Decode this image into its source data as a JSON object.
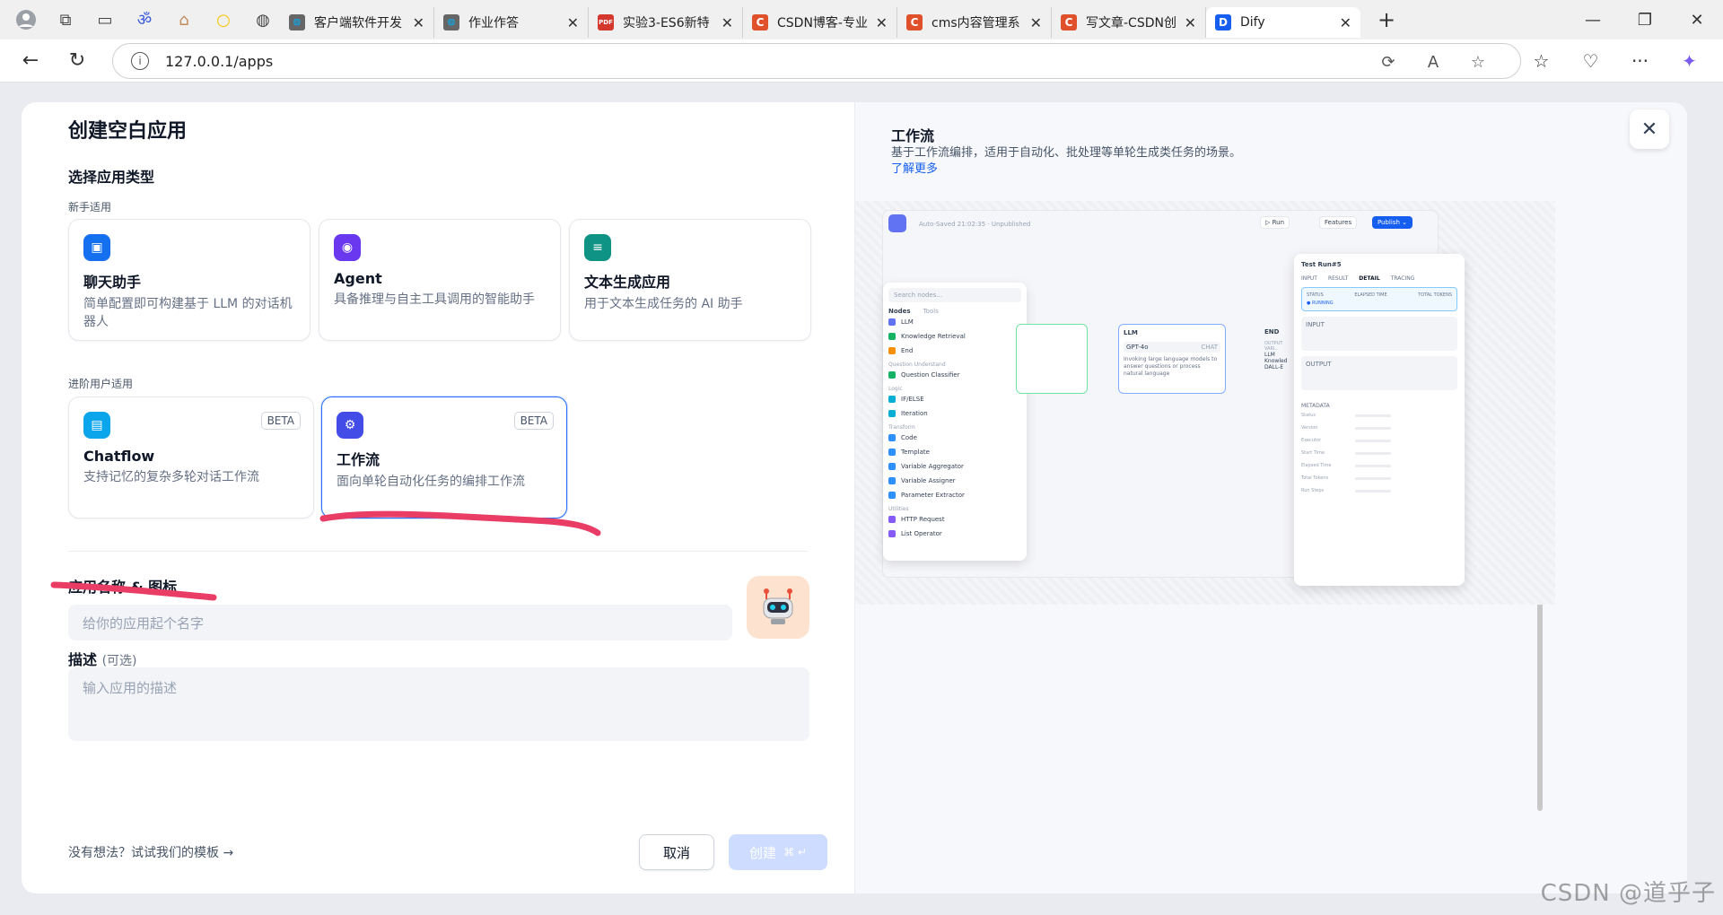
{
  "browser": {
    "tabs": [
      {
        "title": "客户端软件开发",
        "fav_color": "#666",
        "fav": "🌐"
      },
      {
        "title": "作业作答",
        "fav_color": "#666",
        "fav": "🌐"
      },
      {
        "title": "实验3-ES6新特",
        "fav_color": "#d4372c",
        "fav": "PDF"
      },
      {
        "title": "CSDN博客-专业",
        "fav_color": "#e0502b",
        "fav": "C"
      },
      {
        "title": "cms内容管理系",
        "fav_color": "#e0502b",
        "fav": "C"
      },
      {
        "title": "写文章-CSDN创",
        "fav_color": "#e0502b",
        "fav": "C"
      },
      {
        "title": "Dify",
        "fav_color": "#155eef",
        "fav": "D"
      }
    ],
    "url": "127.0.0.1/apps"
  },
  "modal": {
    "title": "创建空白应用",
    "type_heading": "选择应用类型",
    "beginner_caption": "新手适用",
    "advanced_caption": "进阶用户适用",
    "beginner_cards": [
      {
        "name": "聊天助手",
        "desc": "简单配置即可构建基于 LLM 的对话机器人",
        "color": "#1570ef"
      },
      {
        "name": "Agent",
        "desc": "具备推理与自主工具调用的智能助手",
        "color": "#6938ef"
      },
      {
        "name": "文本生成应用",
        "desc": "用于文本生成任务的 AI 助手",
        "color": "#0e9384"
      }
    ],
    "advanced_cards": [
      {
        "name": "Chatflow",
        "desc": "支持记忆的复杂多轮对话工作流",
        "badge": "BETA",
        "color": "#0ba5ec"
      },
      {
        "name": "工作流",
        "desc": "面向单轮自动化任务的编排工作流",
        "badge": "BETA",
        "color": "#444ce7"
      }
    ],
    "name_label": "应用名称 & 图标",
    "name_placeholder": "给你的应用起个名字",
    "desc_label": "描述",
    "desc_optional": "(可选)",
    "desc_placeholder": "输入应用的描述",
    "template_link": "没有想法？试试我们的模板",
    "cancel": "取消",
    "create": "创建"
  },
  "preview": {
    "title": "工作流",
    "desc": "基于工作流编排，适用于自动化、批处理等单轮生成类任务的场景。",
    "learn_more": "了解更多",
    "topbar": "Auto-Saved 21:02:35 · Unpublished",
    "run": "▷ Run",
    "features": "Features",
    "publish": "Publish ⌄",
    "search": "Search nodes...",
    "tabs": [
      "Nodes",
      "Tools"
    ],
    "nodes": [
      {
        "label": "LLM",
        "color": "#6172f3"
      },
      {
        "label": "Knowledge Retrieval",
        "color": "#16b364"
      },
      {
        "label": "End",
        "color": "#f79009"
      }
    ],
    "groups": [
      {
        "name": "Question Understand",
        "items": [
          {
            "label": "Question Classifier",
            "color": "#16b364"
          }
        ]
      },
      {
        "name": "Logic",
        "items": [
          {
            "label": "IF/ELSE",
            "color": "#06aed4"
          },
          {
            "label": "Iteration",
            "color": "#06aed4"
          }
        ]
      },
      {
        "name": "Transform",
        "items": [
          {
            "label": "Code",
            "color": "#2e90fa"
          },
          {
            "label": "Template",
            "color": "#2e90fa"
          },
          {
            "label": "Variable Aggregator",
            "color": "#2e90fa"
          },
          {
            "label": "Variable Assigner",
            "color": "#2e90fa"
          },
          {
            "label": "Parameter Extractor",
            "color": "#2e90fa"
          }
        ]
      },
      {
        "name": "Utilities",
        "items": [
          {
            "label": "HTTP Request",
            "color": "#875bf7"
          },
          {
            "label": "List Operator",
            "color": "#875bf7"
          }
        ]
      }
    ],
    "llm_node": {
      "title": "LLM",
      "model": "GPT-4o",
      "mode": "CHAT",
      "text": "Invoking large language models to answer questions or process natural language"
    },
    "end_node": {
      "title": "END",
      "sub": "OUTPUT VARI..",
      "items": [
        "LLM",
        "Knowled",
        "DALL-E"
      ]
    },
    "test_run": {
      "title": "Test Run#5",
      "tabs": [
        "INPUT",
        "RESULT",
        "DETAIL",
        "TRACING"
      ],
      "status_cols": [
        "STATUS",
        "ELAPSED TIME",
        "TOTAL TOKENS"
      ],
      "status": "● RUNNING",
      "input": "INPUT",
      "output": "OUTPUT",
      "metadata": "METADATA",
      "meta_rows": [
        "Status",
        "Version",
        "Executor",
        "Start Time",
        "Elapsed Time",
        "Total Tokens",
        "Run Steps"
      ]
    }
  },
  "watermark": "CSDN @道乎子"
}
